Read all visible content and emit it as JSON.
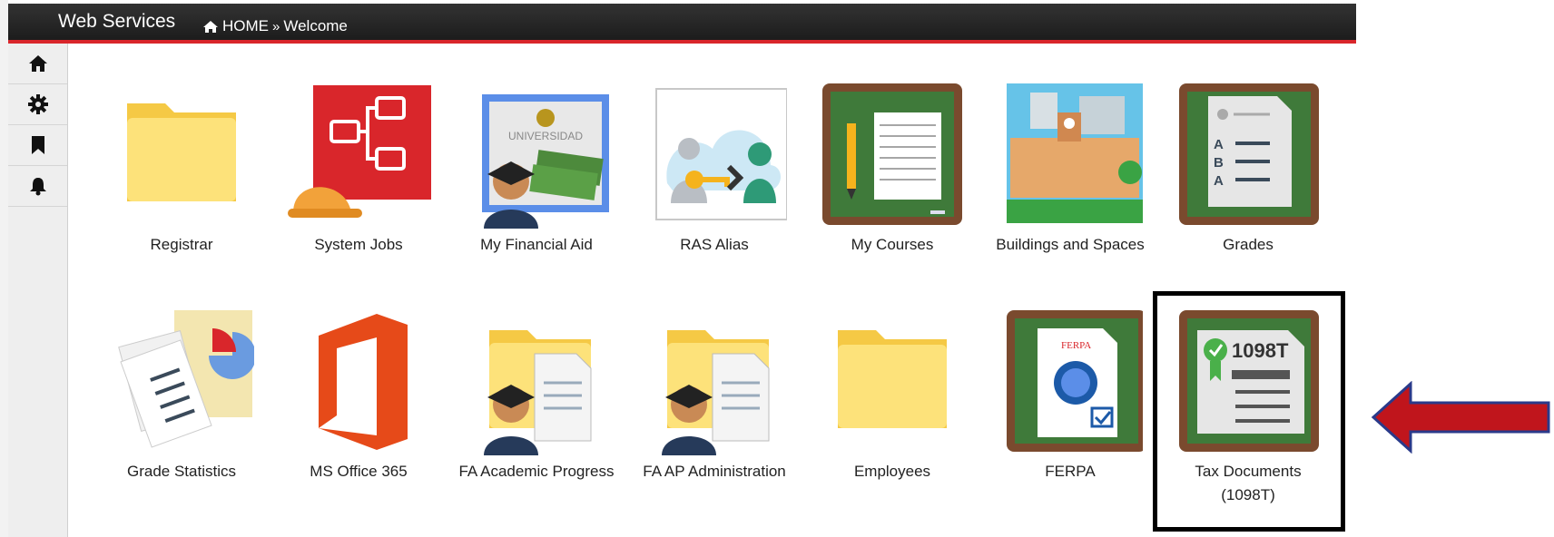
{
  "header": {
    "app_title": "Web Services",
    "breadcrumb": {
      "home": "HOME",
      "separator": "»",
      "current": "Welcome"
    }
  },
  "sidebar": {
    "items": [
      {
        "icon": "home-icon"
      },
      {
        "icon": "gear-icon"
      },
      {
        "icon": "bookmark-icon"
      },
      {
        "icon": "bell-icon"
      }
    ]
  },
  "apps": {
    "row1": [
      "Registrar",
      "System Jobs",
      "My Financial Aid",
      "RAS Alias",
      "My Courses",
      "Buildings and Spaces",
      "Grades"
    ],
    "row2": [
      "Grade Statistics",
      "MS Office 365",
      "FA Academic Progress",
      "FA AP Administration",
      "Employees",
      "FERPA"
    ],
    "tax": {
      "line1": "Tax Documents",
      "line2": "(1098T)",
      "badge": "1098T"
    },
    "university_text": "UNIVERSIDAD",
    "ferpa_text": "FERPA",
    "grade_letters": [
      "A",
      "B",
      "A"
    ]
  },
  "colors": {
    "accent_red": "#d9262b",
    "callout_arrow": "#c0151c",
    "chalkboard": "#3f7a3a",
    "frame": "#7a4a2e",
    "folder": "#fde27a"
  }
}
